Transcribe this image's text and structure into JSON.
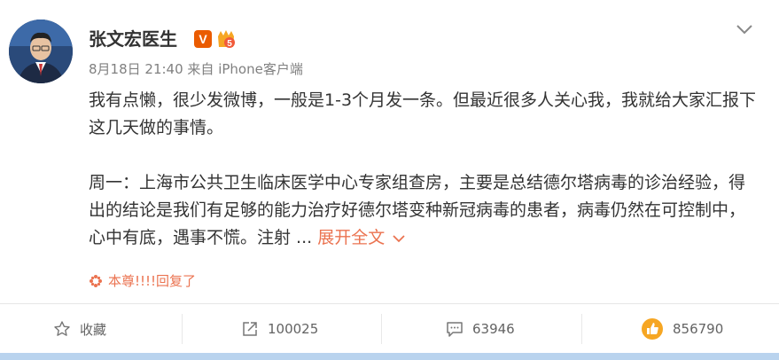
{
  "post": {
    "author": "张文宏医生",
    "verified_badge": "V",
    "level_badge": "5",
    "timestamp": "8月18日 21:40",
    "source": "来自 iPhone客户端",
    "paragraph1": "我有点懒，很少发微博，一般是1-3个月发一条。但最近很多人关心我，我就给大家汇报下这几天做的事情。",
    "paragraph2": "周一：上海市公共卫生临床医学中心专家组查房，主要是总结德尔塔病毒的诊治经验，得出的结论是我们有足够的能力治疗好德尔塔变种新冠病毒的患者，病毒仍然在可控制中，心中有底，遇事不慌。注射 ...",
    "expand_label": "展开全文",
    "reply_notice": "本尊!!!!回复了"
  },
  "actions": {
    "favorite_label": "收藏",
    "repost_count": "100025",
    "comment_count": "63946",
    "like_count": "856790"
  },
  "colors": {
    "accent_orange": "#eb7350",
    "verified_orange": "#ea5b00",
    "text": "#333333",
    "meta": "#808080"
  }
}
